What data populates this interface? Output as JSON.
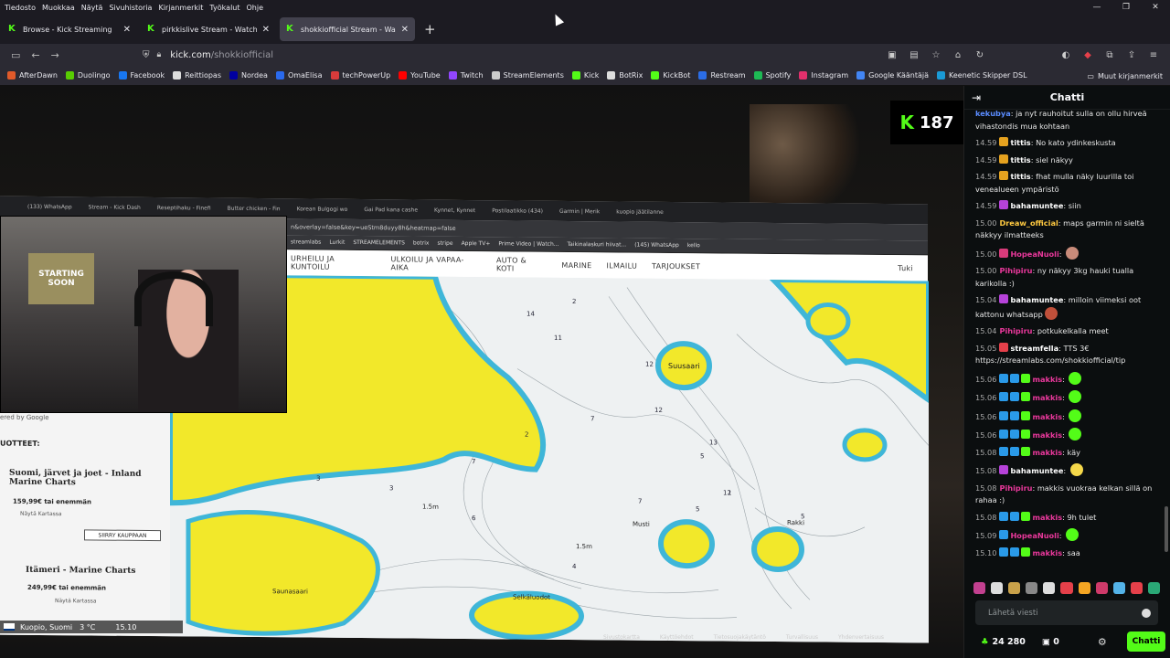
{
  "menu": [
    "Tiedosto",
    "Muokkaa",
    "Näytä",
    "Sivuhistoria",
    "Kirjanmerkit",
    "Työkalut",
    "Ohje"
  ],
  "window_controls": {
    "minimize": "—",
    "restore": "❐",
    "close": "✕"
  },
  "tabs": [
    {
      "label": "Browse - Kick Streaming",
      "active": false
    },
    {
      "label": "pirkkislive Stream - Watch Live on Kick",
      "active": false
    },
    {
      "label": "shokkiofficial Stream - Watch Live on Kick",
      "active": true
    }
  ],
  "url": {
    "domain": "kick.com",
    "path": "/shokkiofficial"
  },
  "bookmarks": [
    {
      "label": "AfterDawn",
      "color": "#e05a2a"
    },
    {
      "label": "Duolingo",
      "color": "#58cc02"
    },
    {
      "label": "Facebook",
      "color": "#1877f2"
    },
    {
      "label": "Reittiopas",
      "color": "#dddddd"
    },
    {
      "label": "Nordea",
      "color": "#0000a0"
    },
    {
      "label": "OmaElisa",
      "color": "#2a6aee"
    },
    {
      "label": "techPowerUp",
      "color": "#d83b3b"
    },
    {
      "label": "YouTube",
      "color": "#ff0000"
    },
    {
      "label": "Twitch",
      "color": "#9146ff"
    },
    {
      "label": "StreamElements",
      "color": "#cccccc"
    },
    {
      "label": "Kick",
      "color": "#53fc18"
    },
    {
      "label": "BotRix",
      "color": "#dddddd"
    },
    {
      "label": "KickBot",
      "color": "#53fc18"
    },
    {
      "label": "Restream",
      "color": "#2b6de6"
    },
    {
      "label": "Spotify",
      "color": "#1db954"
    },
    {
      "label": "Instagram",
      "color": "#e1306c"
    },
    {
      "label": "Google Kääntäjä",
      "color": "#4285f4"
    },
    {
      "label": "Keenetic Skipper DSL",
      "color": "#1a9ad6"
    }
  ],
  "other_bookmarks": "Muut kirjanmerkit",
  "kick_viewer_badge": "187",
  "inner_browser": {
    "tabs": [
      "(133) WhatsApp",
      "Stream - Kick Dash",
      "Reseptihaku - Finefi",
      "Butter chicken - Fin",
      "Korean Bulgogi wo",
      "Gai Pad kana cashe",
      "Kynnet, Kynnet",
      "Postilaatikko (434)",
      "Garmin | Merik",
      "kuopio jäätilanne"
    ],
    "address": "n&overlay=false&key=ueStm8duyy8h&heatmap=false",
    "bookmarks": [
      "streamlabs",
      "Lurkit",
      "STREAMELEMENTS",
      "botrix",
      "stripe",
      "Apple TV+",
      "Prime Video | Watch...",
      "Taikinalaskuri hiivat...",
      "(145) WhatsApp",
      "kello"
    ],
    "nav": [
      "URHEILU JA KUNTOILU",
      "ULKOILU JA VAPAA-AIKA",
      "AUTO & KOTI",
      "MARINE",
      "ILMAILU",
      "TARJOUKSET"
    ],
    "nav_right": "Tuki",
    "powered": "ered by Google",
    "products_heading": "UOTTEET:",
    "products": [
      {
        "title": "Suomi, järvet ja joet - Inland Marine Charts",
        "price": "159,99€ tai enemmän",
        "option": "Näytä Kartassa",
        "button": "SIIRRY KAUPPAAN"
      },
      {
        "title": "Itämeri - Marine Charts",
        "price": "249,99€ tai enemmän",
        "option": "Näytä Kartassa"
      }
    ],
    "map_labels": [
      "Suusaari",
      "Saunasaari",
      "Musti",
      "Rakki",
      "Selkäluodot",
      "1.5m",
      "1.5m"
    ],
    "depth_numbers": [
      "2",
      "14",
      "11",
      "12",
      "12",
      "13",
      "12",
      "5",
      "7",
      "7",
      "3",
      "3",
      "2",
      "4",
      "5",
      "6",
      "7",
      "5",
      "1"
    ],
    "bottom_links": [
      "Sivustokartta",
      "Käyttöehdot",
      "Tietosuojakäytäntö",
      "Turvallisuus",
      "Yhdenvertaisuus"
    ],
    "statusbar": {
      "location": "Kuopio, Suomi",
      "temp": "3 °C",
      "time": "15.10"
    }
  },
  "chat": {
    "title": "Chatti",
    "messages": [
      {
        "time": "",
        "user": "kekubya",
        "color": "#5a8cff",
        "text": "ja nyt rauhoitut sulla on ollu hirveä vihastondis mua kohtaan",
        "badges": []
      },
      {
        "time": "14.59",
        "user": "tittis",
        "color": "#ffffff",
        "text": "No kato ydinkeskusta",
        "badges": [
          "#e5a21f"
        ]
      },
      {
        "time": "14.59",
        "user": "tittis",
        "color": "#ffffff",
        "text": "siel näkyy",
        "badges": [
          "#e5a21f"
        ]
      },
      {
        "time": "14.59",
        "user": "tittis",
        "color": "#ffffff",
        "text": "fhat mulla näky luurilla toi venealueen ympäristö",
        "badges": [
          "#e5a21f"
        ]
      },
      {
        "time": "14.59",
        "user": "bahamuntee",
        "color": "#ffffff",
        "text": "siin",
        "badges": [
          "#b642d9"
        ]
      },
      {
        "time": "15.00",
        "user": "Dreaw_official",
        "color": "#ffc940",
        "text": "maps garmin ni sieltä näkkyy ilmatteeks",
        "badges": []
      },
      {
        "time": "15.00",
        "user": "HopeaNuoli",
        "color": "#e9389b",
        "text": "",
        "badges": [
          "#d83b7a"
        ],
        "emote": "#c98b7a"
      },
      {
        "time": "15.00",
        "user": "Pihipiru",
        "color": "#e9389b",
        "text": "ny näkyy 3kg hauki tualla karikolla :)",
        "badges": []
      },
      {
        "time": "15.04",
        "user": "bahamuntee",
        "color": "#ffffff",
        "text": "milloin viimeksi oot kattonu whatsapp",
        "badges": [
          "#b642d9"
        ],
        "emote": "#c0503a"
      },
      {
        "time": "15.04",
        "user": "Pihipiru",
        "color": "#e9389b",
        "text": "potkukelkalla meet",
        "badges": []
      },
      {
        "time": "15.05",
        "user": "streamfella",
        "color": "#ffffff",
        "text": "TTS 3€ https://streamlabs.com/shokkiofficial/tip",
        "badges": [
          "#e5404a"
        ]
      },
      {
        "time": "15.06",
        "user": "makkis",
        "color": "#e9389b",
        "text": "",
        "badges": [
          "#2a9ae8",
          "#2a9ae8",
          "#53fc18"
        ],
        "emote": "#53fc18"
      },
      {
        "time": "15.06",
        "user": "makkis",
        "color": "#e9389b",
        "text": "",
        "badges": [
          "#2a9ae8",
          "#2a9ae8",
          "#53fc18"
        ],
        "emote": "#53fc18"
      },
      {
        "time": "15.06",
        "user": "makkis",
        "color": "#e9389b",
        "text": "",
        "badges": [
          "#2a9ae8",
          "#2a9ae8",
          "#53fc18"
        ],
        "emote": "#53fc18"
      },
      {
        "time": "15.06",
        "user": "makkis",
        "color": "#e9389b",
        "text": "",
        "badges": [
          "#2a9ae8",
          "#2a9ae8",
          "#53fc18"
        ],
        "emote": "#53fc18"
      },
      {
        "time": "15.08",
        "user": "makkis",
        "color": "#e9389b",
        "text": "käy",
        "badges": [
          "#2a9ae8",
          "#2a9ae8",
          "#53fc18"
        ]
      },
      {
        "time": "15.08",
        "user": "bahamuntee",
        "color": "#ffffff",
        "text": "",
        "badges": [
          "#b642d9"
        ],
        "emote": "#f5d84a"
      },
      {
        "time": "15.08",
        "user": "Pihipiru",
        "color": "#e9389b",
        "text": "makkis vuokraa kelkan sillä on rahaa :)",
        "badges": []
      },
      {
        "time": "15.08",
        "user": "makkis",
        "color": "#e9389b",
        "text": "9h tulet",
        "badges": [
          "#2a9ae8",
          "#2a9ae8",
          "#53fc18"
        ]
      },
      {
        "time": "15.09",
        "user": "HopeaNuoli",
        "color": "#e9389b",
        "text": "",
        "badges": [
          "#2a9ae8"
        ],
        "emote": "#53fc18"
      },
      {
        "time": "15.10",
        "user": "makkis",
        "color": "#e9389b",
        "text": "saa",
        "badges": [
          "#2a9ae8",
          "#2a9ae8",
          "#53fc18"
        ]
      }
    ],
    "input_placeholder": "Lähetä viesti",
    "points": "24 280",
    "gifts": "0",
    "send_label": "Chatti",
    "emote_colors": [
      "#c2408f",
      "#dddddd",
      "#c9a24a",
      "#888888",
      "#dddddd",
      "#e5404a",
      "#f5a623",
      "#cf3a6a",
      "#53b3e8",
      "#e5404a",
      "#2aa876"
    ]
  }
}
